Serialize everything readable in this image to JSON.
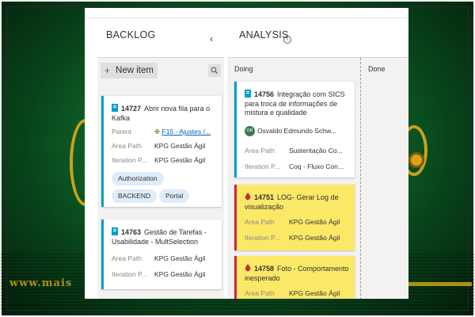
{
  "watermark": "www.mais",
  "board": {
    "backlog_title": "BACKLOG",
    "collapse_icon": "chevron-left-icon",
    "analysis_title": "ANALYSIS",
    "info_icon": "i",
    "new_item_label": "New item",
    "columns": {
      "doing": "Doing",
      "done": "Done"
    }
  },
  "colors": {
    "story_accent": "#009ccc",
    "bug_accent": "#cc293d",
    "bug_background": "#fce867",
    "tag_background": "#deecf9"
  },
  "backlog_cards": [
    {
      "id": "14727",
      "title": "Abrir nova fila para o Kafka",
      "type_icon": "book-icon",
      "parent_label": "Parent",
      "parent_value": "F15 - Ajustes /...",
      "area_label": "Area Path",
      "area_value": "KPG Gestão Ágil",
      "iteration_label": "Iteration P...",
      "iteration_value": "KPG Gestão Ágil",
      "tags": [
        "Authorization",
        "BACKEND",
        "Portal"
      ]
    },
    {
      "id": "14763",
      "title": "Gestão de Tarefas - Usabilidade - MultSelection",
      "type_icon": "book-icon",
      "area_label": "Area Path",
      "area_value": "KPG Gestão Ágil",
      "iteration_label": "Iteration P...",
      "iteration_value": "KPG Gestão Ágil"
    }
  ],
  "doing_cards": [
    {
      "id": "14756",
      "title": "Integração com SICS para troca de informações de mistura e qualidade",
      "type_icon": "book-icon",
      "assignee_initials": "OR",
      "assignee": "Osvaldo Edmundo Schw...",
      "area_label": "Area Path",
      "area_value": "Sustentação Co...",
      "iteration_label": "Iteration P...",
      "iteration_value": "Coq - Fluxo Con..."
    },
    {
      "id": "14751",
      "title": "LOG- Gerar Log de visualização",
      "type_icon": "bug-icon",
      "area_label": "Area Path",
      "area_value": "KPG Gestão Ágil",
      "iteration_label": "Iteration P...",
      "iteration_value": "KPG Gestão Ágil"
    },
    {
      "id": "14758",
      "title": "Foto - Comportamento inesperado",
      "type_icon": "bug-icon",
      "area_label": "Area Path",
      "area_value": "KPG Gestão Ágil"
    }
  ]
}
